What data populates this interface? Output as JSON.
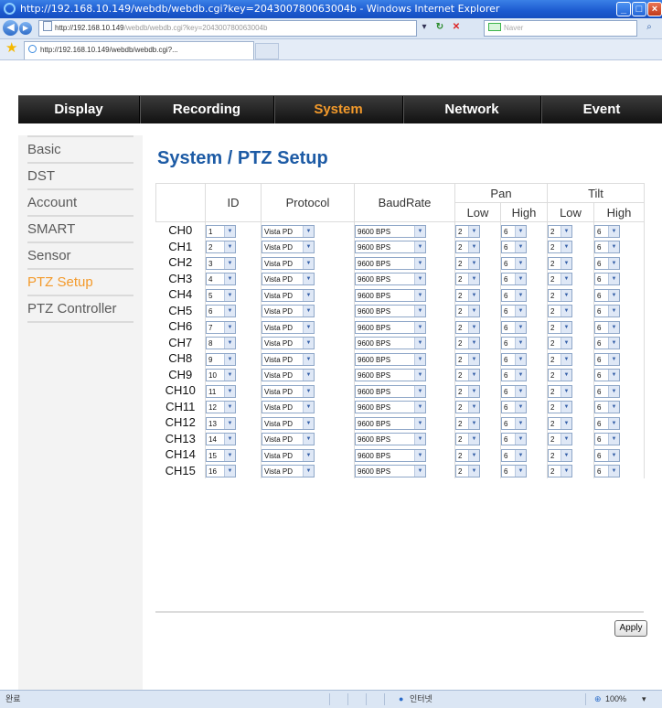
{
  "browser": {
    "window_title": "http://192.168.10.149/webdb/webdb.cgi?key=204300780063004b - Windows Internet Explorer",
    "address_prefix": "http://192.168.10.149",
    "address_rest": "/webdb/webdb.cgi?key=204300780063004b",
    "search_placeholder": "Naver",
    "tab_title": "http://192.168.10.149/webdb/webdb.cgi?...",
    "status_left": "완료",
    "status_zone": "인터넷",
    "zoom": "100%"
  },
  "nav": {
    "items": [
      "Display",
      "Recording",
      "System",
      "Network",
      "Event"
    ],
    "active": "System"
  },
  "sidebar": {
    "items": [
      "Basic",
      "DST",
      "Account",
      "SMART",
      "Sensor",
      "PTZ Setup",
      "PTZ Controller"
    ],
    "active": "PTZ Setup"
  },
  "page_title": "System / PTZ Setup",
  "table": {
    "headers": {
      "id": "ID",
      "protocol": "Protocol",
      "baudrate": "BaudRate",
      "pan": "Pan",
      "tilt": "Tilt",
      "low": "Low",
      "high": "High"
    },
    "rows": [
      {
        "ch": "CH0",
        "id": "1",
        "protocol": "Vista PD",
        "baud": "9600 BPS",
        "pan_low": "2",
        "pan_high": "6",
        "tilt_low": "2",
        "tilt_high": "6"
      },
      {
        "ch": "CH1",
        "id": "2",
        "protocol": "Vista PD",
        "baud": "9600 BPS",
        "pan_low": "2",
        "pan_high": "6",
        "tilt_low": "2",
        "tilt_high": "6"
      },
      {
        "ch": "CH2",
        "id": "3",
        "protocol": "Vista PD",
        "baud": "9600 BPS",
        "pan_low": "2",
        "pan_high": "6",
        "tilt_low": "2",
        "tilt_high": "6"
      },
      {
        "ch": "CH3",
        "id": "4",
        "protocol": "Vista PD",
        "baud": "9600 BPS",
        "pan_low": "2",
        "pan_high": "6",
        "tilt_low": "2",
        "tilt_high": "6"
      },
      {
        "ch": "CH4",
        "id": "5",
        "protocol": "Vista PD",
        "baud": "9600 BPS",
        "pan_low": "2",
        "pan_high": "6",
        "tilt_low": "2",
        "tilt_high": "6"
      },
      {
        "ch": "CH5",
        "id": "6",
        "protocol": "Vista PD",
        "baud": "9600 BPS",
        "pan_low": "2",
        "pan_high": "6",
        "tilt_low": "2",
        "tilt_high": "6"
      },
      {
        "ch": "CH6",
        "id": "7",
        "protocol": "Vista PD",
        "baud": "9600 BPS",
        "pan_low": "2",
        "pan_high": "6",
        "tilt_low": "2",
        "tilt_high": "6"
      },
      {
        "ch": "CH7",
        "id": "8",
        "protocol": "Vista PD",
        "baud": "9600 BPS",
        "pan_low": "2",
        "pan_high": "6",
        "tilt_low": "2",
        "tilt_high": "6"
      },
      {
        "ch": "CH8",
        "id": "9",
        "protocol": "Vista PD",
        "baud": "9600 BPS",
        "pan_low": "2",
        "pan_high": "6",
        "tilt_low": "2",
        "tilt_high": "6"
      },
      {
        "ch": "CH9",
        "id": "10",
        "protocol": "Vista PD",
        "baud": "9600 BPS",
        "pan_low": "2",
        "pan_high": "6",
        "tilt_low": "2",
        "tilt_high": "6"
      },
      {
        "ch": "CH10",
        "id": "11",
        "protocol": "Vista PD",
        "baud": "9600 BPS",
        "pan_low": "2",
        "pan_high": "6",
        "tilt_low": "2",
        "tilt_high": "6"
      },
      {
        "ch": "CH11",
        "id": "12",
        "protocol": "Vista PD",
        "baud": "9600 BPS",
        "pan_low": "2",
        "pan_high": "6",
        "tilt_low": "2",
        "tilt_high": "6"
      },
      {
        "ch": "CH12",
        "id": "13",
        "protocol": "Vista PD",
        "baud": "9600 BPS",
        "pan_low": "2",
        "pan_high": "6",
        "tilt_low": "2",
        "tilt_high": "6"
      },
      {
        "ch": "CH13",
        "id": "14",
        "protocol": "Vista PD",
        "baud": "9600 BPS",
        "pan_low": "2",
        "pan_high": "6",
        "tilt_low": "2",
        "tilt_high": "6"
      },
      {
        "ch": "CH14",
        "id": "15",
        "protocol": "Vista PD",
        "baud": "9600 BPS",
        "pan_low": "2",
        "pan_high": "6",
        "tilt_low": "2",
        "tilt_high": "6"
      },
      {
        "ch": "CH15",
        "id": "16",
        "protocol": "Vista PD",
        "baud": "9600 BPS",
        "pan_low": "2",
        "pan_high": "6",
        "tilt_low": "2",
        "tilt_high": "6"
      }
    ]
  },
  "apply_label": "Apply",
  "icons": {
    "dropdown": "chevron-down-icon",
    "back": "back-arrow-icon",
    "forward": "forward-arrow-icon",
    "favorites": "star-icon"
  }
}
